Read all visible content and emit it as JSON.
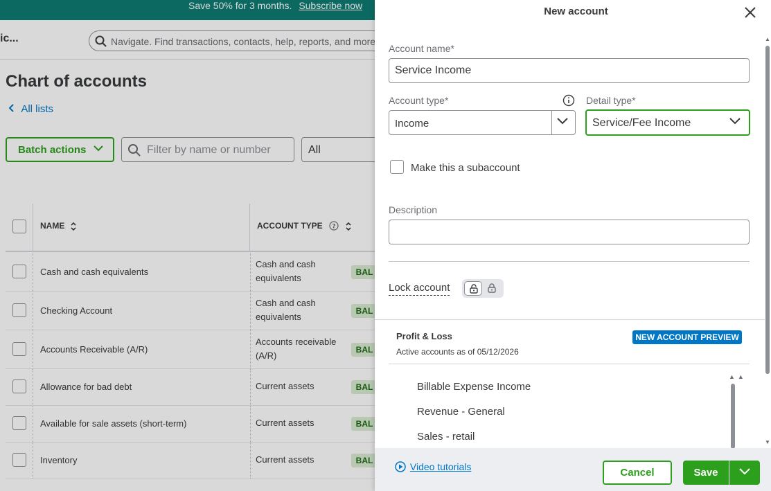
{
  "promo": {
    "text": "Save 50% for 3 months.",
    "link": "Subscribe now"
  },
  "header": {
    "company": "ic...",
    "search_placeholder": "Navigate. Find transactions, contacts, help, reports, and more"
  },
  "page": {
    "title": "Chart of accounts",
    "back_link": "All lists",
    "batch_actions": "Batch actions",
    "filter_placeholder": "Filter by name or number",
    "type_filter": "All",
    "columns": {
      "name": "NAME",
      "account_type": "ACCOUNT TYPE"
    },
    "rows": [
      {
        "name": "Cash and cash equivalents",
        "type_line1": "Cash and cash",
        "type_line2": "equivalents",
        "badge": "BAL"
      },
      {
        "name": "Checking Account",
        "type_line1": "Cash and cash",
        "type_line2": "equivalents",
        "badge": "BAL"
      },
      {
        "name": "Accounts Receivable (A/R)",
        "type_line1": "Accounts receivable",
        "type_line2": "(A/R)",
        "badge": "BAL"
      },
      {
        "name": "Allowance for bad debt",
        "type_line1": "Current assets",
        "type_line2": "",
        "badge": "BAL"
      },
      {
        "name": "Available for sale assets (short-term)",
        "type_line1": "Current assets",
        "type_line2": "",
        "badge": "BAL"
      },
      {
        "name": "Inventory",
        "type_line1": "Current assets",
        "type_line2": "",
        "badge": "BAL"
      }
    ]
  },
  "drawer": {
    "title": "New account",
    "account_name_label": "Account name*",
    "account_name_value": "Service Income",
    "account_type_label": "Account type*",
    "account_type_value": "Income",
    "detail_type_label": "Detail type*",
    "detail_type_value": "Service/Fee Income",
    "subaccount_label": "Make this a subaccount",
    "description_label": "Description",
    "description_value": "",
    "lock_label": "Lock account",
    "preview": {
      "title": "Profit & Loss",
      "subtitle": "Active accounts as of 05/12/2026",
      "badge": "NEW ACCOUNT PREVIEW",
      "items": [
        "Billable Expense Income",
        "Revenue - General",
        "Sales - retail"
      ]
    },
    "footer": {
      "video_link": "Video tutorials",
      "cancel": "Cancel",
      "save": "Save"
    }
  },
  "colors": {
    "brand_green": "#2ca01c",
    "link_blue": "#0077c5",
    "promo_teal": "#0d7c72"
  }
}
